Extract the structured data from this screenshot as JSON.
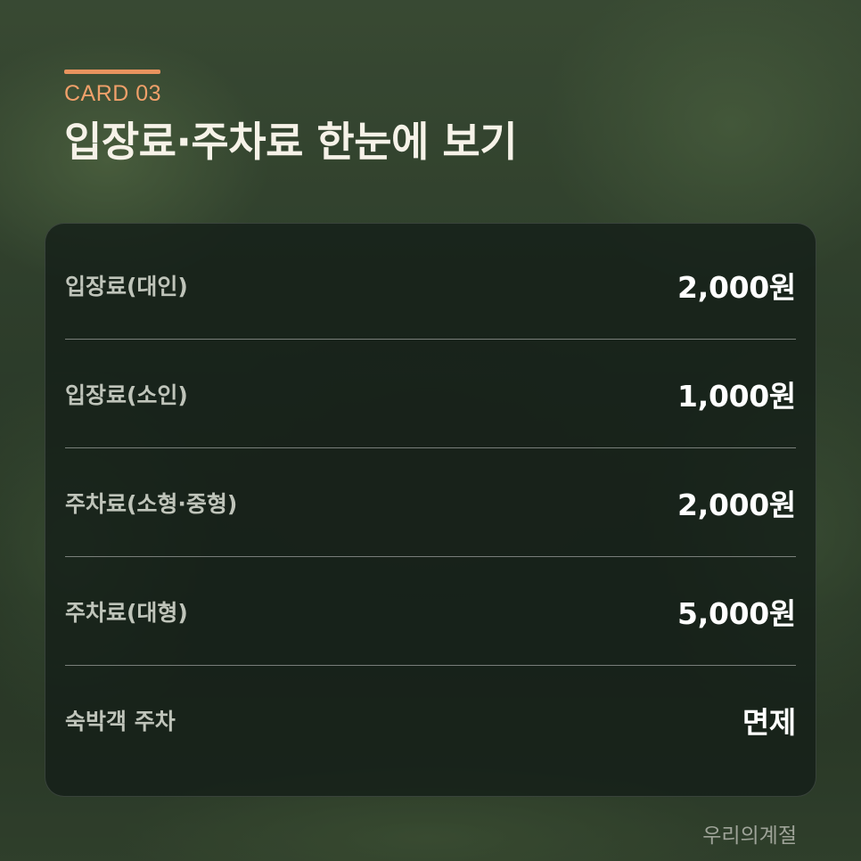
{
  "header": {
    "eyebrow": "CARD 03",
    "title": "입장료·주차료 한눈에 보기"
  },
  "fees": [
    {
      "label": "입장료(대인)",
      "value": "2,000원"
    },
    {
      "label": "입장료(소인)",
      "value": "1,000원"
    },
    {
      "label": "주차료(소형·중형)",
      "value": "2,000원"
    },
    {
      "label": "주차료(대형)",
      "value": "5,000원"
    },
    {
      "label": "숙박객 주차",
      "value": "면제"
    }
  ],
  "footer": {
    "source": "우리의계절"
  },
  "colors": {
    "accent": "#e8935e",
    "title": "#f6f2e8",
    "card_bg": "#141e18"
  }
}
